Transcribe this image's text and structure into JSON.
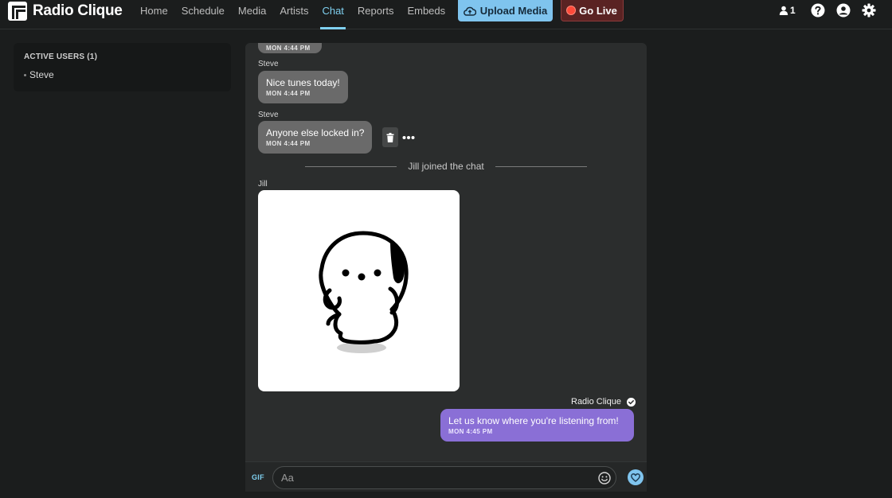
{
  "app": {
    "name": "Radio Clique"
  },
  "nav": {
    "items": [
      {
        "label": "Home"
      },
      {
        "label": "Schedule"
      },
      {
        "label": "Media"
      },
      {
        "label": "Artists"
      },
      {
        "label": "Chat"
      },
      {
        "label": "Reports"
      },
      {
        "label": "Embeds"
      }
    ],
    "active": "Chat"
  },
  "toolbar": {
    "upload_label": "Upload Media",
    "golive_label": "Go Live",
    "listener_count": "1"
  },
  "sidebar": {
    "title": "ACTIVE USERS (1)",
    "users": [
      "Steve"
    ]
  },
  "chat": {
    "partial_timestamp": "MON 4:44 PM",
    "messages": [
      {
        "sender": "Steve",
        "text": "Nice tunes today!",
        "time": "MON 4:44 PM"
      },
      {
        "sender": "Steve",
        "text": "Anyone else locked in?",
        "time": "MON 4:44 PM"
      }
    ],
    "system_event": "Jill joined the chat",
    "image_sender": "Jill",
    "own_message": {
      "sender": "Radio Clique",
      "text": "Let us know where you're listening from!",
      "time": "MON 4:45 PM"
    }
  },
  "composer": {
    "gif_label": "GIF",
    "placeholder": "Aa"
  },
  "colors": {
    "accent": "#7fd0f0",
    "upload_button": "#7fc4ee",
    "golive_button": "#5a2323",
    "own_bubble": "#8a6fd6",
    "other_bubble": "#6a6a6a"
  },
  "icons": [
    "logo-icon",
    "cloud-upload-icon",
    "record-dot-icon",
    "user-icon",
    "help-icon",
    "account-icon",
    "settings-icon",
    "trash-icon",
    "more-icon",
    "verified-icon",
    "emoji-icon",
    "heart-icon"
  ]
}
